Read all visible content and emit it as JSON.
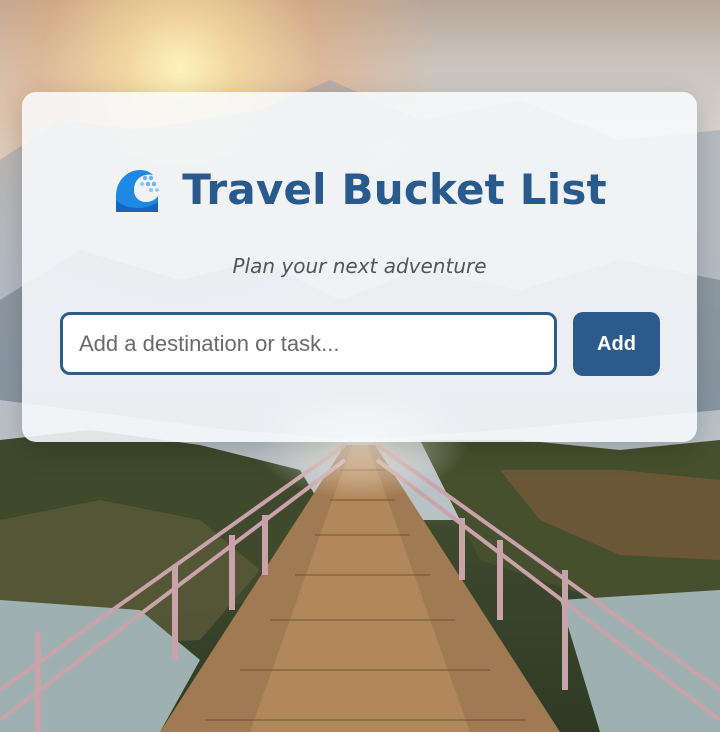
{
  "header": {
    "icon": "water-wave-icon",
    "title": "Travel Bucket List",
    "subtitle": "Plan your next adventure"
  },
  "form": {
    "placeholder": "Add a destination or task...",
    "value": "",
    "add_label": "Add"
  },
  "colors": {
    "accent": "#2b5b8c",
    "title": "#285a8e",
    "icon_blue": "#1e88e5"
  },
  "background": "bridge-mountain-sunrise-photo"
}
